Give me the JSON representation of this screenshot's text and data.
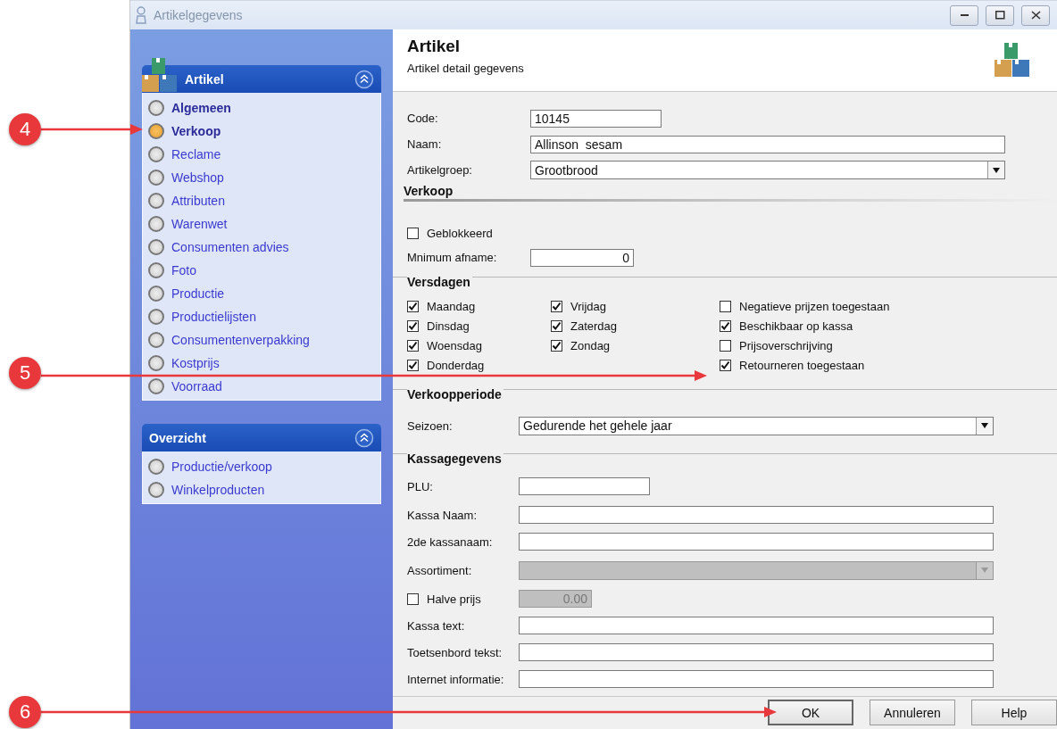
{
  "window": {
    "title": "Artikelgegevens"
  },
  "sidebar": {
    "groups": [
      {
        "title": "Artikel",
        "items": [
          {
            "label": "Algemeen",
            "selected": false,
            "bold": true
          },
          {
            "label": "Verkoop",
            "selected": true,
            "bold": true
          },
          {
            "label": "Reclame",
            "selected": false,
            "bold": false
          },
          {
            "label": "Webshop",
            "selected": false,
            "bold": false
          },
          {
            "label": "Attributen",
            "selected": false,
            "bold": false
          },
          {
            "label": "Warenwet",
            "selected": false,
            "bold": false
          },
          {
            "label": "Consumenten advies",
            "selected": false,
            "bold": false
          },
          {
            "label": "Foto",
            "selected": false,
            "bold": false
          },
          {
            "label": "Productie",
            "selected": false,
            "bold": false
          },
          {
            "label": "Productielijsten",
            "selected": false,
            "bold": false
          },
          {
            "label": "Consumentenverpakking",
            "selected": false,
            "bold": false
          },
          {
            "label": "Kostprijs",
            "selected": false,
            "bold": false
          },
          {
            "label": "Voorraad",
            "selected": false,
            "bold": false
          }
        ]
      },
      {
        "title": "Overzicht",
        "items": [
          {
            "label": "Productie/verkoop",
            "selected": false,
            "bold": false
          },
          {
            "label": "Winkelproducten",
            "selected": false,
            "bold": false
          }
        ]
      }
    ]
  },
  "header": {
    "title": "Artikel",
    "subtitle": "Artikel detail gegevens"
  },
  "fields": [
    {
      "kind": "short",
      "label": "Code:",
      "value": "10145"
    },
    {
      "kind": "text",
      "label": "Naam:",
      "value": "Allinson  sesam"
    },
    {
      "kind": "dropdown",
      "label": "Artikelgroep:",
      "value": "Grootbrood"
    }
  ],
  "sections": [
    {
      "title": "Verkoop",
      "rows": [
        {
          "kind": "checkbox",
          "label": "Geblokkeerd",
          "checked": false
        },
        {
          "kind": "number",
          "label": "Mnimum afname:",
          "value": "0"
        }
      ]
    },
    {
      "title": "Versdagen",
      "columns": [
        [
          {
            "label": "Maandag",
            "checked": true
          },
          {
            "label": "Dinsdag",
            "checked": true
          },
          {
            "label": "Woensdag",
            "checked": true
          },
          {
            "label": "Donderdag",
            "checked": true
          }
        ],
        [
          {
            "label": "Vrijdag",
            "checked": true
          },
          {
            "label": "Zaterdag",
            "checked": true
          },
          {
            "label": "Zondag",
            "checked": true
          }
        ],
        [
          {
            "label": "Negatieve prijzen toegestaan",
            "checked": false
          },
          {
            "label": "Beschikbaar op kassa",
            "checked": true
          },
          {
            "label": "Prijsoverschrijving",
            "checked": false
          },
          {
            "label": "Retourneren toegestaan",
            "checked": true
          }
        ]
      ]
    },
    {
      "title": "Verkoopperiode",
      "rows": [
        {
          "kind": "dropdown",
          "label": "Seizoen:",
          "value": "Gedurende het gehele jaar",
          "disabled": false
        }
      ]
    },
    {
      "title": "Kassagegevens",
      "rows": [
        {
          "kind": "short",
          "label": "PLU:",
          "disabled": false
        },
        {
          "kind": "text",
          "label": "Kassa Naam:",
          "disabled": false
        },
        {
          "kind": "text",
          "label": "2de kassanaam:",
          "disabled": false
        },
        {
          "kind": "dropdown",
          "label": "Assortiment:",
          "disabled": true
        },
        {
          "kind": "checkbox_number",
          "label": "Halve prijs",
          "checked": false,
          "value": "0.00",
          "disabled": true
        },
        {
          "kind": "text",
          "label": "Kassa text:",
          "disabled": false
        },
        {
          "kind": "text",
          "label": "Toetsenbord tekst:",
          "disabled": false
        },
        {
          "kind": "text",
          "label": "Internet informatie:",
          "disabled": false
        }
      ]
    }
  ],
  "buttons": [
    {
      "label": "OK",
      "default": true
    },
    {
      "label": "Annuleren",
      "default": false
    },
    {
      "label": "Help",
      "default": false
    }
  ],
  "callouts": [
    {
      "number": "4"
    },
    {
      "number": "5"
    },
    {
      "number": "6"
    }
  ]
}
